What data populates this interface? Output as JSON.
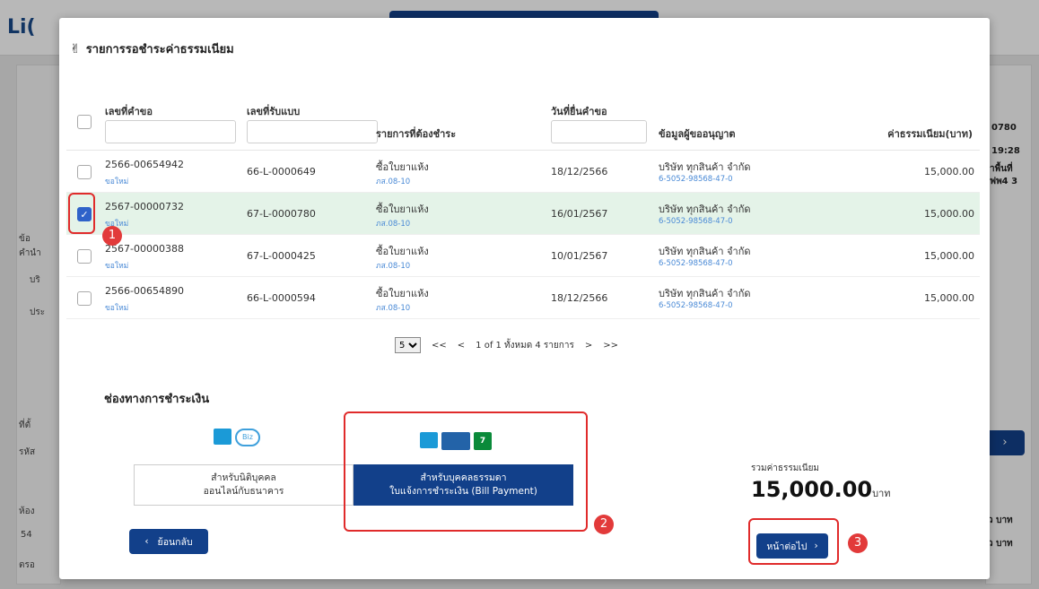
{
  "background": {
    "logo": "Li(",
    "right_texts": [
      "0780",
      "19:28",
      "าพื้นที่",
      "ฟพ4 3",
      "ว บาท",
      "ว บาท"
    ],
    "left_texts": [
      "ข้อ",
      "คำนำ",
      "บริ",
      "ประ",
      "ที่ตั้",
      "รหัส",
      "ห้อง",
      "54",
      "ตรอ"
    ]
  },
  "modal": {
    "title": "รายการรอชำระค่าธรรมเนียม",
    "table": {
      "headers": {
        "request_no": "เลขที่คำขอ",
        "form_no": "เลขที่รับแบบ",
        "item": "รายการที่ต้องชำระ",
        "submit_date": "วันที่ยื่นคำขอ",
        "applicant": "ข้อมูลผู้ขออนุญาต",
        "fee": "ค่าธรรมเนียม(บาท)"
      },
      "rows": [
        {
          "checked": false,
          "request_no": "2566-00654942",
          "request_type": "ขอใหม่",
          "form_no": "66-L-0000649",
          "item": "ซื้อใบยาแห้ง",
          "item_code": "ภส.08-10",
          "date": "18/12/2566",
          "company": "บริษัท ทุกสินค้า จำกัด",
          "tax_id": "6-5052-98568-47-0",
          "fee": "15,000.00"
        },
        {
          "checked": true,
          "request_no": "2567-00000732",
          "request_type": "ขอใหม่",
          "form_no": "67-L-0000780",
          "item": "ซื้อใบยาแห้ง",
          "item_code": "ภส.08-10",
          "date": "16/01/2567",
          "company": "บริษัท ทุกสินค้า จำกัด",
          "tax_id": "6-5052-98568-47-0",
          "fee": "15,000.00"
        },
        {
          "checked": false,
          "request_no": "2567-00000388",
          "request_type": "ขอใหม่",
          "form_no": "67-L-0000425",
          "item": "ซื้อใบยาแห้ง",
          "item_code": "ภส.08-10",
          "date": "10/01/2567",
          "company": "บริษัท ทุกสินค้า จำกัด",
          "tax_id": "6-5052-98568-47-0",
          "fee": "15,000.00"
        },
        {
          "checked": false,
          "request_no": "2566-00654890",
          "request_type": "ขอใหม่",
          "form_no": "66-L-0000594",
          "item": "ซื้อใบยาแห้ง",
          "item_code": "ภส.08-10",
          "date": "18/12/2566",
          "company": "บริษัท ทุกสินค้า จำกัด",
          "tax_id": "6-5052-98568-47-0",
          "fee": "15,000.00"
        }
      ]
    },
    "pagination": {
      "page_size": "5",
      "first": "<<",
      "prev": "<",
      "info": "1 of 1 ทั้งหมด 4 รายการ",
      "next": ">",
      "last": ">>"
    },
    "payment": {
      "section_title": "ช่องทางการชำระเงิน",
      "option_corporate": {
        "line1": "สำหรับนิติบุคคล",
        "line2": "ออนไลน์กับธนาคาร",
        "logo_text": "Biz"
      },
      "option_individual": {
        "line1": "สำหรับบุคคลธรรมดา",
        "line2": "ใบแจ้งการชำระเงิน (Bill Payment)",
        "logo_711": "7"
      }
    },
    "total": {
      "label": "รวมค่าธรรมเนียม",
      "value": "15,000.00",
      "unit": "บาท"
    },
    "buttons": {
      "back": "ย้อนกลับ",
      "next": "หน้าต่อไป"
    }
  },
  "annotations": {
    "step1": "1",
    "step2": "2",
    "step3": "3"
  },
  "colors": {
    "primary": "#12408a",
    "selected_row": "#e4f3e8",
    "highlight": "#e02b2b",
    "link": "#4a8ad6"
  }
}
